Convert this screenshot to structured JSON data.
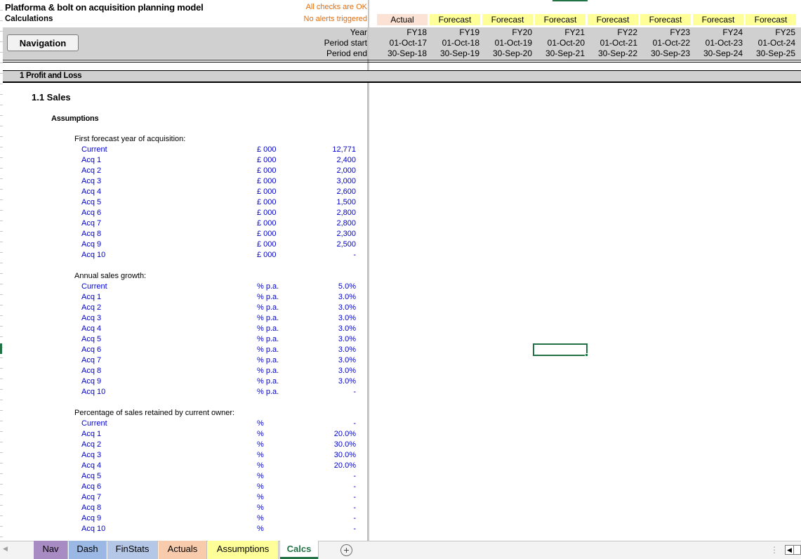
{
  "header": {
    "title": "Platforma & bolt on acquisition planning model",
    "subtitle": "Calculations",
    "checks_ok": "All checks are OK",
    "no_alerts": "No alerts triggered",
    "nav_button_label": "Navigation",
    "period_labels": {
      "year": "Year",
      "start": "Period start",
      "end": "Period end"
    }
  },
  "columns": [
    {
      "type": "Actual",
      "year": "FY18",
      "start": "01-Oct-17",
      "end": "30-Sep-18"
    },
    {
      "type": "Forecast",
      "year": "FY19",
      "start": "01-Oct-18",
      "end": "30-Sep-19"
    },
    {
      "type": "Forecast",
      "year": "FY20",
      "start": "01-Oct-19",
      "end": "30-Sep-20"
    },
    {
      "type": "Forecast",
      "year": "FY21",
      "start": "01-Oct-20",
      "end": "30-Sep-21"
    },
    {
      "type": "Forecast",
      "year": "FY22",
      "start": "01-Oct-21",
      "end": "30-Sep-22"
    },
    {
      "type": "Forecast",
      "year": "FY23",
      "start": "01-Oct-22",
      "end": "30-Sep-23"
    },
    {
      "type": "Forecast",
      "year": "FY24",
      "start": "01-Oct-23",
      "end": "30-Sep-24"
    },
    {
      "type": "Forecast",
      "year": "FY25",
      "start": "01-Oct-24",
      "end": "30-Sep-25"
    }
  ],
  "section": {
    "title": "1 Profit and Loss",
    "subsection": "1.1  Sales",
    "assumptions": "Assumptions"
  },
  "groups": [
    {
      "heading": "First forecast year of acquisition:",
      "rows": [
        {
          "label": "Current",
          "unit": "£ 000",
          "value": "12,771"
        },
        {
          "label": "Acq 1",
          "unit": "£ 000",
          "value": "2,400"
        },
        {
          "label": "Acq 2",
          "unit": "£ 000",
          "value": "2,000"
        },
        {
          "label": "Acq 3",
          "unit": "£ 000",
          "value": "3,000"
        },
        {
          "label": "Acq 4",
          "unit": "£ 000",
          "value": "2,600"
        },
        {
          "label": "Acq 5",
          "unit": "£ 000",
          "value": "1,500"
        },
        {
          "label": "Acq 6",
          "unit": "£ 000",
          "value": "2,800"
        },
        {
          "label": "Acq 7",
          "unit": "£ 000",
          "value": "2,800"
        },
        {
          "label": "Acq 8",
          "unit": "£ 000",
          "value": "2,300"
        },
        {
          "label": "Acq 9",
          "unit": "£ 000",
          "value": "2,500"
        },
        {
          "label": "Acq 10",
          "unit": "£ 000",
          "value": "-"
        }
      ]
    },
    {
      "heading": "Annual sales growth:",
      "rows": [
        {
          "label": "Current",
          "unit": "% p.a.",
          "value": "5.0%"
        },
        {
          "label": "Acq 1",
          "unit": "% p.a.",
          "value": "3.0%"
        },
        {
          "label": "Acq 2",
          "unit": "% p.a.",
          "value": "3.0%"
        },
        {
          "label": "Acq 3",
          "unit": "% p.a.",
          "value": "3.0%"
        },
        {
          "label": "Acq 4",
          "unit": "% p.a.",
          "value": "3.0%"
        },
        {
          "label": "Acq 5",
          "unit": "% p.a.",
          "value": "3.0%"
        },
        {
          "label": "Acq 6",
          "unit": "% p.a.",
          "value": "3.0%"
        },
        {
          "label": "Acq 7",
          "unit": "% p.a.",
          "value": "3.0%"
        },
        {
          "label": "Acq 8",
          "unit": "% p.a.",
          "value": "3.0%"
        },
        {
          "label": "Acq 9",
          "unit": "% p.a.",
          "value": "3.0%"
        },
        {
          "label": "Acq 10",
          "unit": "% p.a.",
          "value": "-"
        }
      ]
    },
    {
      "heading": "Percentage of sales retained by current owner:",
      "rows": [
        {
          "label": "Current",
          "unit": "%",
          "value": "-"
        },
        {
          "label": "Acq 1",
          "unit": "%",
          "value": "20.0%"
        },
        {
          "label": "Acq 2",
          "unit": "%",
          "value": "30.0%"
        },
        {
          "label": "Acq 3",
          "unit": "%",
          "value": "30.0%"
        },
        {
          "label": "Acq 4",
          "unit": "%",
          "value": "20.0%"
        },
        {
          "label": "Acq 5",
          "unit": "%",
          "value": "-"
        },
        {
          "label": "Acq 6",
          "unit": "%",
          "value": "-"
        },
        {
          "label": "Acq 7",
          "unit": "%",
          "value": "-"
        },
        {
          "label": "Acq 8",
          "unit": "%",
          "value": "-"
        },
        {
          "label": "Acq 9",
          "unit": "%",
          "value": "-"
        },
        {
          "label": "Acq 10",
          "unit": "%",
          "value": "-"
        }
      ]
    }
  ],
  "tabs": [
    {
      "label": "Nav",
      "color": "#a98bc4",
      "active": false
    },
    {
      "label": "Dash",
      "color": "#9bb7e3",
      "active": false
    },
    {
      "label": "FinStats",
      "color": "#b4c7e7",
      "active": false
    },
    {
      "label": "Actuals",
      "color": "#f8cbad",
      "active": false
    },
    {
      "label": "Assumptions",
      "color": "#ffff99",
      "active": false
    },
    {
      "label": "Calcs",
      "color": "#217346",
      "active": true
    }
  ],
  "icons": {
    "add_sheet": "plus-circle-icon",
    "tab_prev": "triangle-left-icon",
    "tab_more": "ellipsis-icon",
    "scroll_left": "scroll-left-icon"
  },
  "colors": {
    "warning_text": "#e46c0a",
    "input_blue": "#0000cc",
    "actual_fill": "#fbe2d5",
    "forecast_fill": "#ffff99",
    "header_grey": "#d0d0d0",
    "excel_green": "#217346"
  }
}
